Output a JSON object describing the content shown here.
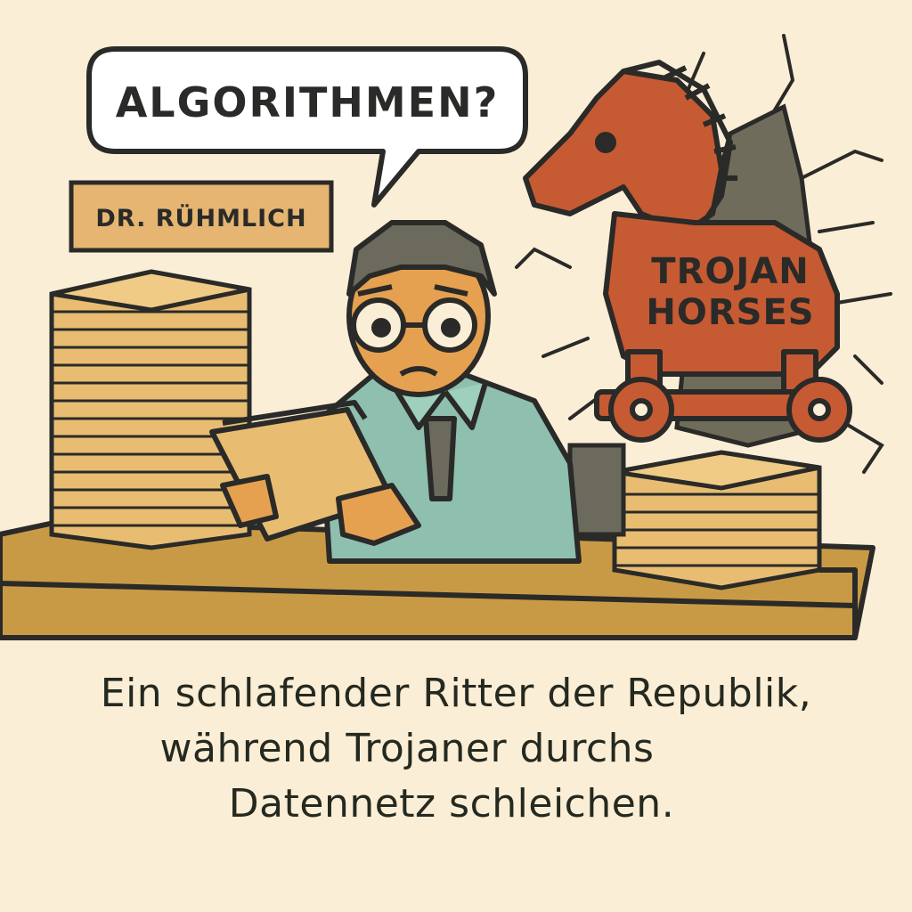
{
  "speech_bubble": {
    "text": "ALGORITHMEN?"
  },
  "name_plate": {
    "text": "DR. RÜHMLICH"
  },
  "horse_label": {
    "line1": "TROJAN",
    "line2": "HORSES"
  },
  "caption": {
    "line1": "Ein schlafender Ritter der Republik,",
    "line2": "während Trojaner durchs",
    "line3": "Datennetz schleichen."
  },
  "colors": {
    "background": "#fbeed6",
    "desk": "#c99a45",
    "paper": "#e8bd72",
    "shirt": "#8fbfae",
    "skin": "#e6a150",
    "hair": "#6b6a5c",
    "horse": "#c65a33",
    "outline": "#2a2a28"
  }
}
